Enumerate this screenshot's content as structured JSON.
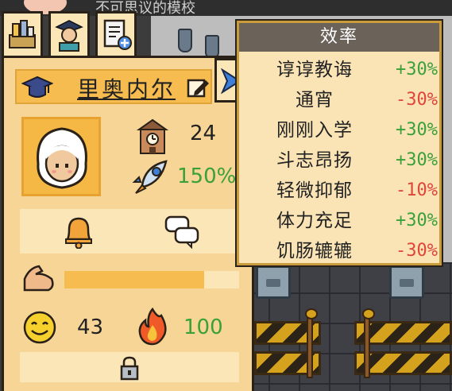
{
  "background_hint": "不可思议的模校",
  "character": {
    "name": "里奥内尔",
    "level": "24",
    "speed_percent": "150%",
    "energy_progress": 0.8,
    "mood": "43",
    "passion": "100"
  },
  "tooltip": {
    "title": "效率",
    "rows": [
      {
        "label": "谆谆教诲",
        "value": "+30%",
        "positive": true
      },
      {
        "label": "通宵",
        "value": "-30%",
        "positive": false
      },
      {
        "label": "刚刚入学",
        "value": "+30%",
        "positive": true
      },
      {
        "label": "斗志昂扬",
        "value": "+30%",
        "positive": true
      },
      {
        "label": "轻微抑郁",
        "value": "-10%",
        "positive": false
      },
      {
        "label": "体力充足",
        "value": "+30%",
        "positive": true
      },
      {
        "label": "饥肠辘辘",
        "value": "-30%",
        "positive": false
      }
    ]
  },
  "icons": {
    "tab1": "items-basket-icon",
    "tab2": "teacher-portrait-icon",
    "tab3": "document-add-icon",
    "graduation": "graduation-cap-icon",
    "edit": "pencil-edit-icon",
    "expand": "chevron-right-icon",
    "level": "school-building-icon",
    "speed": "rocket-icon",
    "bell": "bell-icon",
    "chat": "chat-bubble-icon",
    "strength": "muscle-arm-icon",
    "mood": "smiley-face-icon",
    "passion": "fire-icon",
    "lock": "padlock-icon"
  },
  "colors": {
    "positive": "#3aa03a",
    "negative": "#e0453a",
    "panel": "#f7d596",
    "accent": "#f6bc4f"
  }
}
